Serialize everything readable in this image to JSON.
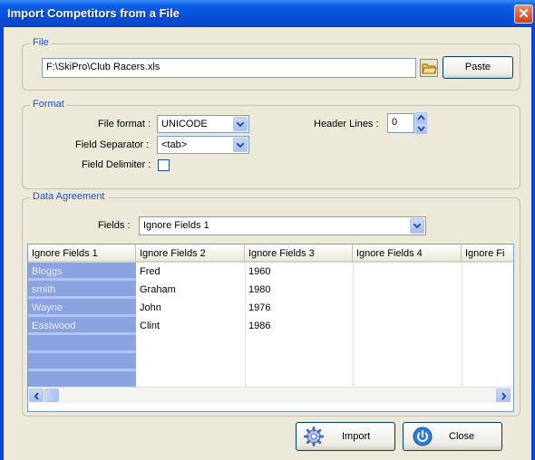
{
  "window": {
    "title": "Import Competitors from a File",
    "close_glyph": "✕"
  },
  "file_group": {
    "legend": "File",
    "path_value": "F:\\SkiPro\\Club Racers.xls",
    "browse_icon": "folder-icon",
    "paste_label": "Paste"
  },
  "format_group": {
    "legend": "Format",
    "file_format_label": "File format :",
    "file_format_value": "UNICODE",
    "field_separator_label": "Field Separator :",
    "field_separator_value": "<tab>",
    "field_delimiter_label": "Field Delimiter :",
    "field_delimiter_checked": false,
    "header_lines_label": "Header Lines :",
    "header_lines_value": "0"
  },
  "data_group": {
    "legend": "Data Agreement",
    "fields_label": "Fields :",
    "fields_value": "Ignore Fields 1",
    "columns": [
      "Ignore Fields 1",
      "Ignore Fields 2",
      "Ignore Fields 3",
      "Ignore Fields 4",
      "Ignore Fi"
    ],
    "rows": [
      [
        "Bloggs",
        "Fred",
        "1960",
        "",
        ""
      ],
      [
        "smith",
        "Graham",
        "1980",
        "",
        ""
      ],
      [
        "Wayne",
        "John",
        "1976",
        "",
        ""
      ],
      [
        "Eastwood",
        "Clint",
        "1986",
        "",
        ""
      ]
    ]
  },
  "buttons": {
    "import_label": "Import",
    "close_label": "Close"
  },
  "colors": {
    "title_bar": "#0b5ee8",
    "dialog_bg": "#ece9d8",
    "legend_text": "#1f53c6",
    "selected_column": "#8aa2e0"
  }
}
